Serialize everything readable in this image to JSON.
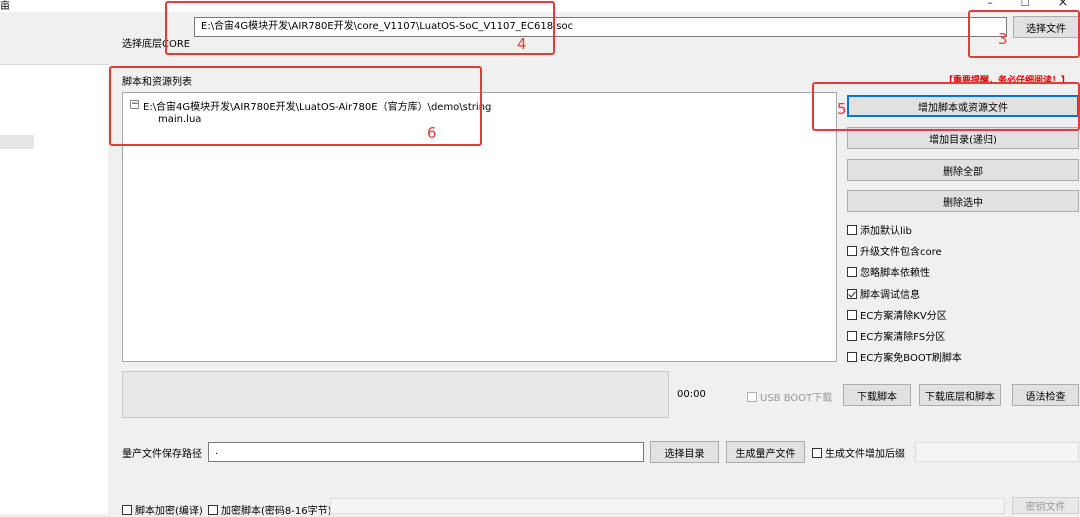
{
  "window": {
    "title_fragment": "亩",
    "controls": {
      "minimize": "–",
      "maximize": "□",
      "close": "×"
    }
  },
  "core": {
    "label": "选择底层CORE",
    "path": "E:\\合宙4G模块开发\\AIR780E开发\\core_V1107\\LuatOS-SoC_V1107_EC618.soc",
    "select_button": "选择文件"
  },
  "scripts": {
    "section_label": "脚本和资源列表",
    "warning": "【重要提醒，务必仔细阅读！】",
    "tree": {
      "folder": "E:\\合宙4G模块开发\\AIR780E开发\\LuatOS-Air780E（官方库）\\demo\\string",
      "files": [
        "main.lua"
      ],
      "toggle": "−"
    },
    "buttons": {
      "add_script": "增加脚本或资源文件",
      "add_dir": "增加目录(递归)",
      "delete_all": "删除全部",
      "delete_selected": "删除选中"
    },
    "options": [
      {
        "label": "添加默认lib",
        "checked": false
      },
      {
        "label": "升级文件包含core",
        "checked": false
      },
      {
        "label": "忽略脚本依赖性",
        "checked": false
      },
      {
        "label": "脚本调试信息",
        "checked": true
      },
      {
        "label": "EC方案清除KV分区",
        "checked": false
      },
      {
        "label": "EC方案清除FS分区",
        "checked": false
      },
      {
        "label": "EC方案免BOOT刷脚本",
        "checked": false
      }
    ]
  },
  "download": {
    "timer": "00:00",
    "usb_boot": "USB BOOT下载",
    "download_script": "下载脚本",
    "download_core_script": "下载底层和脚本",
    "syntax_check": "语法检查"
  },
  "production": {
    "label": "量产文件保存路径",
    "path": ".",
    "select_dir": "选择目录",
    "generate": "生成量产文件",
    "suffix_option": "生成文件增加后缀"
  },
  "encryption": {
    "encrypt_compile": "脚本加密(编译)",
    "encrypt_key": "加密脚本(密码8-16字节)",
    "key_file_button": "密钥文件"
  },
  "annotations": [
    "3",
    "4",
    "5",
    "6"
  ],
  "colors": {
    "annotation_red": "#e03c3c",
    "focus_blue": "#0078d7",
    "warning_red": "#e00000"
  }
}
